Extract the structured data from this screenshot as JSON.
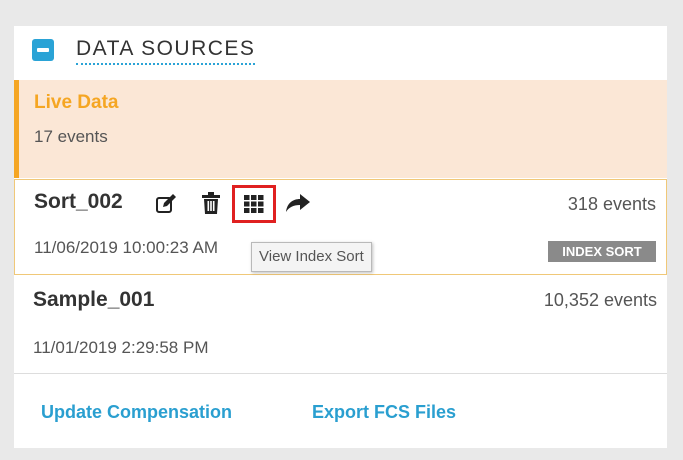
{
  "header": {
    "title": "DATA SOURCES"
  },
  "sources": [
    {
      "name": "Live Data",
      "events": "17 events"
    },
    {
      "name": "Sort_002",
      "events": "318 events",
      "date": "11/06/2019 10:00:23 AM",
      "badge": "INDEX SORT"
    },
    {
      "name": "Sample_001",
      "events": "10,352 events",
      "date": "11/01/2019 2:29:58 PM"
    }
  ],
  "tooltip": "View Index Sort",
  "footer": {
    "update_compensation": "Update Compensation",
    "export_fcs": "Export FCS Files"
  },
  "icons": {
    "collapse": "minus-square-icon",
    "edit": "edit-icon",
    "delete": "trash-icon",
    "index_sort": "grid-icon",
    "share": "share-arrow-icon"
  },
  "colors": {
    "accent": "#2aa3d6",
    "live": "#f5a623",
    "live_bg": "#fbe7d6",
    "highlight_border": "#e02020",
    "badge_bg": "#8a8a8a"
  }
}
